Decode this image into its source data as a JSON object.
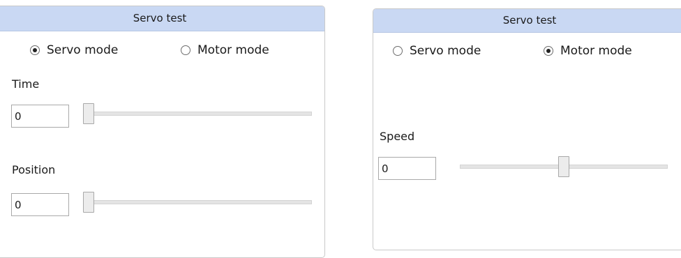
{
  "panels": {
    "servo": {
      "title": "Servo test",
      "modes": [
        {
          "label": "Servo mode",
          "checked": true
        },
        {
          "label": "Motor mode",
          "checked": false
        }
      ],
      "time": {
        "label": "Time",
        "value": "0",
        "slider_fraction": 0.0
      },
      "position": {
        "label": "Position",
        "value": "0",
        "slider_fraction": 0.0
      }
    },
    "motor": {
      "title": "Servo test",
      "modes": [
        {
          "label": "Servo mode",
          "checked": false
        },
        {
          "label": "Motor mode",
          "checked": true
        }
      ],
      "speed": {
        "label": "Speed",
        "value": "0",
        "slider_fraction": 0.5
      }
    }
  },
  "colors": {
    "header_bg": "#c9d8f3",
    "border": "#c9c9c9"
  }
}
